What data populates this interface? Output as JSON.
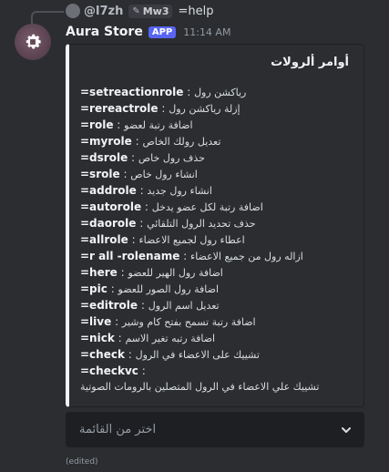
{
  "reply": {
    "username": "@l7zh",
    "tag": "Mw3",
    "command": "=help"
  },
  "message": {
    "bot_name": "Aura Store",
    "badge": "APP",
    "timestamp": "11:14 AM",
    "edited": "(edited)"
  },
  "embed": {
    "title": "أوامر ألرولات",
    "commands": [
      {
        "name": "=setreactionrole",
        "desc": "رياكشن رول"
      },
      {
        "name": "=rereactrole",
        "desc": "إزلة رياكشن رول"
      },
      {
        "name": "=role",
        "desc": "اضافة رتبة لعضو"
      },
      {
        "name": "=myrole",
        "desc": "تعديل رولك الخاص"
      },
      {
        "name": "=dsrole",
        "desc": "حذف رول خاص"
      },
      {
        "name": "=srole",
        "desc": "انشاء رول خاص"
      },
      {
        "name": "=addrole",
        "desc": "انشاء رول جديد"
      },
      {
        "name": "=autorole",
        "desc": "اضافة رتبة لكل عضو يدخل"
      },
      {
        "name": "=daorole",
        "desc": "حذف تحديد الرول التلقائي"
      },
      {
        "name": "=allrole",
        "desc": "اعطاء رول لجميع الاعضاء"
      },
      {
        "name": "=r all -rolename",
        "desc": "ازاله رول من جميع الاعضاء"
      },
      {
        "name": "=here",
        "desc": "اضافة رول الهير للعضو"
      },
      {
        "name": "=pic",
        "desc": "اضافة رول الصور للعضو"
      },
      {
        "name": "=editrole",
        "desc": "تعديل اسم الرول"
      },
      {
        "name": "=live",
        "desc": "اضافة رتبة تسمح بفتح كام وشير"
      },
      {
        "name": "=nick",
        "desc": "اضافة رتبه تغير الاسم"
      },
      {
        "name": "=check",
        "desc": "تشييك على الاعضاء في الرول"
      },
      {
        "name": "=checkvc",
        "desc": "تشييك علي الاعضاء في الرول المتصلين بالرومات الصوتية"
      }
    ]
  },
  "select_menu": {
    "placeholder": "اختر من القائمة"
  },
  "colors": {
    "background": "#2b2d31",
    "accent_badge": "#5865f2",
    "embed_border": "#f2f3f5",
    "select_bg": "#1e1f22"
  },
  "icons": {
    "avatar": "gear-icon",
    "select": "chevron-down-icon"
  }
}
